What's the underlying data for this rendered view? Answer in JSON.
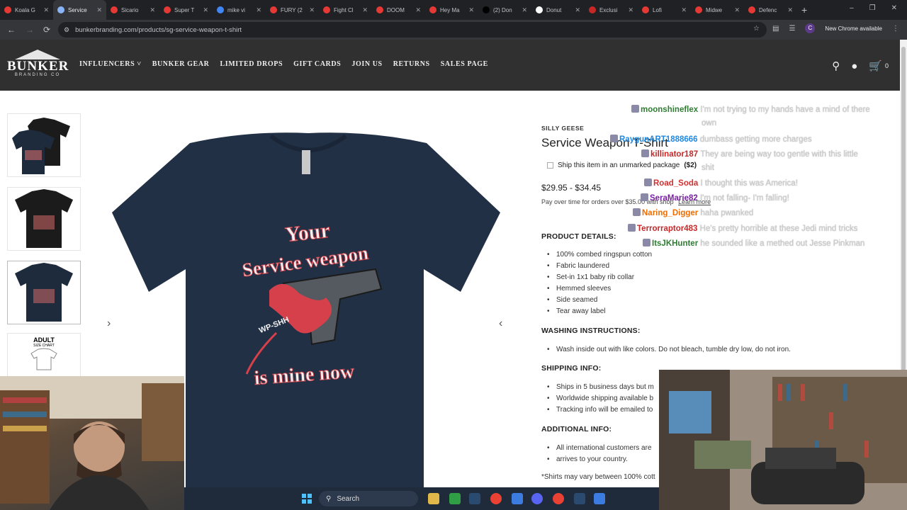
{
  "browser": {
    "tabs": [
      {
        "label": "Koala G",
        "color": "#e53935"
      },
      {
        "label": "Service",
        "color": "#8ab4f8",
        "active": true
      },
      {
        "label": "Sicario",
        "color": "#e53935"
      },
      {
        "label": "Super T",
        "color": "#e53935"
      },
      {
        "label": "mike vi",
        "color": "#4285f4"
      },
      {
        "label": "FURY (2",
        "color": "#e53935"
      },
      {
        "label": "Fight Cl",
        "color": "#e53935"
      },
      {
        "label": "DOOM",
        "color": "#e53935"
      },
      {
        "label": "Hey Ma",
        "color": "#e53935"
      },
      {
        "label": "(2) Don",
        "color": "#000000"
      },
      {
        "label": "Donut",
        "color": "#ffffff"
      },
      {
        "label": "Exclusi",
        "color": "#c62828"
      },
      {
        "label": "Lofi",
        "color": "#e53935"
      },
      {
        "label": "Midwe",
        "color": "#e53935"
      },
      {
        "label": "Defenc",
        "color": "#e53935"
      }
    ],
    "url": "bunkerbranding.com/products/sg-service-weapon-t-shirt",
    "profile_initial": "C",
    "new_chrome": "New Chrome available"
  },
  "site": {
    "logo_word": "BUNKER",
    "logo_sub": "BRANDING CO",
    "nav": [
      "INFLUENCERS",
      "BUNKER GEAR",
      "LIMITED DROPS",
      "GIFT CARDS",
      "JOIN US",
      "RETURNS",
      "SALES PAGE"
    ],
    "cart_count": "0"
  },
  "product": {
    "vendor": "SILLY GEESE",
    "title": "Service Weapon T-Shirt",
    "unmarked_label": "Ship this item in an unmarked package",
    "unmarked_price": "($2)",
    "price": "$29.95 - $34.45",
    "payover": "Pay over time for orders over $35.00 with shop",
    "learn_more": "Learn more",
    "details_heading": "PRODUCT DETAILS:",
    "details": [
      "100% combed ringspun cotton",
      "Fabric laundered",
      "Set-in 1x1 baby rib collar",
      "Hemmed sleeves",
      "Side seamed",
      "Tear away label"
    ],
    "washing_heading": "WASHING INSTRUCTIONS:",
    "washing": [
      "Wash inside out with like colors. Do not bleach, tumble dry low, do not iron."
    ],
    "shipping_heading": "SHIPPING INFO:",
    "shipping": [
      "Ships in 5 business days but m",
      "Worldwide shipping available b",
      "Tracking info will be emailed to"
    ],
    "additional_heading": "ADDITIONAL INFO:",
    "additional": [
      "All international customers are",
      "arrives to your country."
    ],
    "footnote": "*Shirts may vary between 100% cott",
    "shirt_text_top": "Your",
    "shirt_text_mid": "Service weapon",
    "shirt_text_bottom": "is mine now",
    "shirt_sfx": "WP-SHH",
    "size_chart_label": "ADULT",
    "size_chart_sub": "SIZE CHART"
  },
  "chat": [
    {
      "user": "moonshineflex",
      "color": "#2e7d32",
      "msg": "I'm not trying to my hands have a mind of there"
    },
    {
      "user": "",
      "color": "#2e7d32",
      "msg": "own"
    },
    {
      "user": "RaygunART1888666",
      "color": "#1e88e5",
      "msg": "dumbass getting more charges"
    },
    {
      "user": "killinator187",
      "color": "#c62828",
      "msg": "They are being way too gentle with this little"
    },
    {
      "user": "",
      "color": "#c62828",
      "msg": "shit"
    },
    {
      "user": "Road_Soda",
      "color": "#d32f2f",
      "msg": "I thought this was America!"
    },
    {
      "user": "SeraMarie82",
      "color": "#7b1fa2",
      "msg": "I'm not falling- I'm falling!"
    },
    {
      "user": "Naring_Digger",
      "color": "#ef6c00",
      "msg": "haha pwanked"
    },
    {
      "user": "Terrorraptor483",
      "color": "#c62828",
      "msg": "He's pretty horrible at these Jedi mind tricks"
    },
    {
      "user": "ItsJKHunter",
      "color": "#2e7d32",
      "msg": "he sounded like a methed out Jesse Pinkman"
    }
  ],
  "taskbar": {
    "search": "Search"
  }
}
